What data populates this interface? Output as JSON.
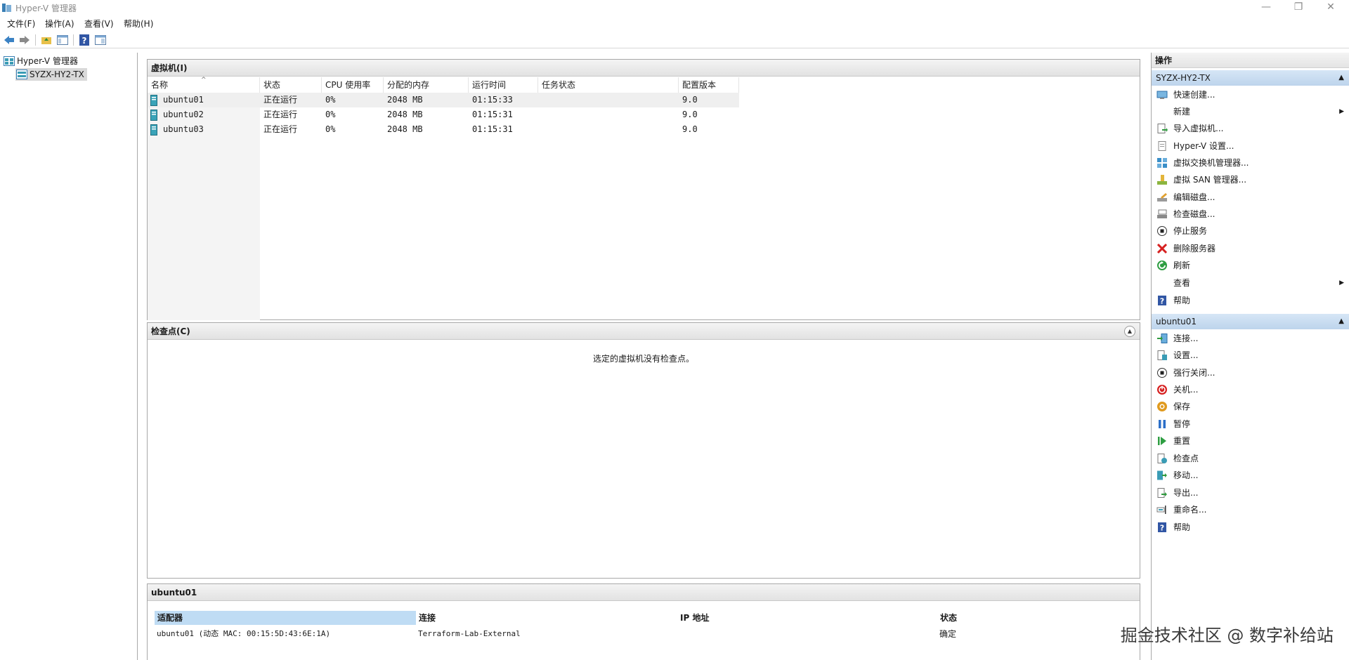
{
  "window": {
    "title": "Hyper-V 管理器",
    "minimize": "—",
    "restore": "❐",
    "close": "✕"
  },
  "menu": [
    "文件(F)",
    "操作(A)",
    "查看(V)",
    "帮助(H)"
  ],
  "tree": {
    "root": "Hyper-V 管理器",
    "server": "SYZX-HY2-TX"
  },
  "vms": {
    "title": "虚拟机(I)",
    "columns": [
      "名称",
      "状态",
      "CPU 使用率",
      "分配的内存",
      "运行时间",
      "任务状态",
      "配置版本"
    ],
    "rows": [
      [
        "ubuntu01",
        "正在运行",
        "0%",
        "2048 MB",
        "01:15:33",
        "",
        "9.0"
      ],
      [
        "ubuntu02",
        "正在运行",
        "0%",
        "2048 MB",
        "01:15:31",
        "",
        "9.0"
      ],
      [
        "ubuntu03",
        "正在运行",
        "0%",
        "2048 MB",
        "01:15:31",
        "",
        "9.0"
      ]
    ]
  },
  "checkpoints": {
    "title": "检查点(C)",
    "empty": "选定的虚拟机没有检查点。"
  },
  "details": {
    "title": "ubuntu01",
    "columns": [
      "适配器",
      "连接",
      "IP 地址",
      "状态"
    ],
    "row": [
      "ubuntu01 (动态 MAC: 00:15:5D:43:6E:1A)",
      "Terraform-Lab-External",
      "",
      "确定"
    ]
  },
  "actions": {
    "title": "操作",
    "server_section": "SYZX-HY2-TX",
    "server_items": [
      "快速创建...",
      "新建",
      "导入虚拟机...",
      "Hyper-V 设置...",
      "虚拟交换机管理器...",
      "虚拟 SAN 管理器...",
      "编辑磁盘...",
      "检查磁盘...",
      "停止服务",
      "删除服务器",
      "刷新",
      "查看",
      "帮助"
    ],
    "vm_section": "ubuntu01",
    "vm_items": [
      "连接...",
      "设置...",
      "强行关闭...",
      "关机...",
      "保存",
      "暂停",
      "重置",
      "检查点",
      "移动...",
      "导出...",
      "重命名...",
      "帮助"
    ]
  },
  "watermark": "掘金技术社区 @ 数字补给站"
}
